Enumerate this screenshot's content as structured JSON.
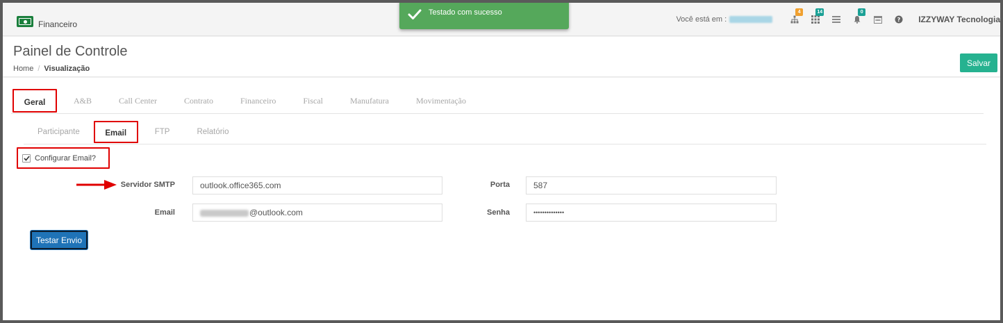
{
  "brand": {
    "label": "Financeiro",
    "icon": "money-bill-icon",
    "color": "#1a7f3c"
  },
  "toast": {
    "message": "Testado com sucesso",
    "color": "#55a85b",
    "icon": "check-icon"
  },
  "topbar": {
    "location_label": "Você está em :",
    "badges": {
      "sitemap": "4",
      "apps": "14",
      "notifications": "0"
    },
    "company": "IZZYWAY Tecnologia"
  },
  "page": {
    "title": "Painel de Controle",
    "breadcrumb": {
      "home": "Home",
      "separator": "/",
      "current": "Visualização"
    },
    "save_label": "Salvar"
  },
  "tabs": [
    "Geral",
    "A&B",
    "Call Center",
    "Contrato",
    "Financeiro",
    "Fiscal",
    "Manufatura",
    "Movimentação"
  ],
  "subtabs": [
    "Participante",
    "Email",
    "FTP",
    "Relatório"
  ],
  "form": {
    "configure_label": "Configurar Email?",
    "configure_checked": true,
    "smtp_label": "Servidor SMTP",
    "smtp_value": "outlook.office365.com",
    "porta_label": "Porta",
    "porta_value": "587",
    "email_label": "Email",
    "email_domain": "@outlook.com",
    "senha_label": "Senha",
    "senha_value": "••••••••••••••",
    "test_button": "Testar Envio"
  },
  "colors": {
    "accent_save": "#26b290",
    "test_button": "#1f73b7",
    "highlight": "#e00000"
  }
}
